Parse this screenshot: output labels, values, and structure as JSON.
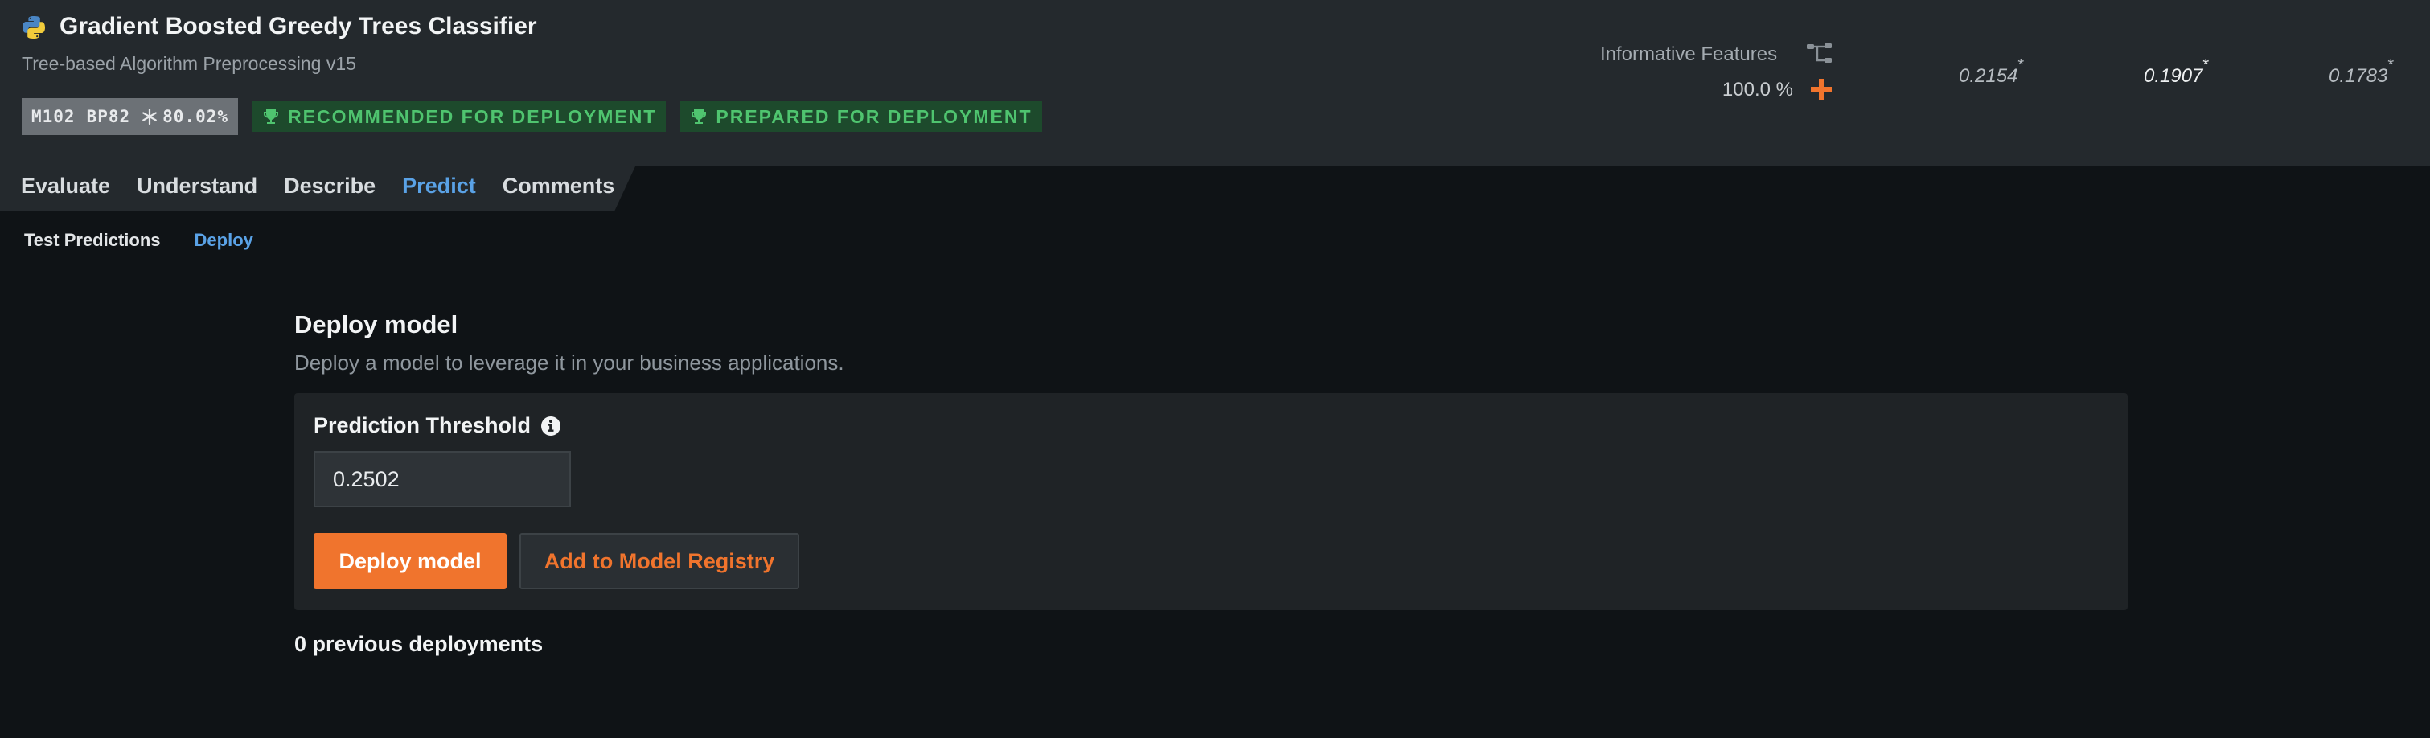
{
  "model": {
    "title": "Gradient Boosted Greedy Trees Classifier",
    "subtitle": "Tree-based Algorithm Preprocessing v15",
    "icon": "python-icon",
    "id_badge": {
      "model_id": "M102",
      "blueprint": "BP82",
      "sample_pct": "80.02%"
    },
    "tags": [
      "RECOMMENDED FOR DEPLOYMENT",
      "PREPARED FOR DEPLOYMENT"
    ]
  },
  "features": {
    "label": "Informative Features",
    "value": "100.0 %"
  },
  "metrics": [
    {
      "value": "0.2154",
      "mark": "*"
    },
    {
      "value": "0.1907",
      "mark": "*"
    },
    {
      "value": "0.1783",
      "mark": "*"
    }
  ],
  "tabs": [
    {
      "label": "Evaluate",
      "active": false
    },
    {
      "label": "Understand",
      "active": false
    },
    {
      "label": "Describe",
      "active": false
    },
    {
      "label": "Predict",
      "active": true
    },
    {
      "label": "Comments",
      "active": false
    }
  ],
  "subtabs": [
    {
      "label": "Test Predictions",
      "active": false
    },
    {
      "label": "Deploy",
      "active": true
    }
  ],
  "deploy": {
    "title": "Deploy model",
    "description": "Deploy a model to leverage it in your business applications.",
    "threshold_label": "Prediction Threshold",
    "threshold_value": "0.2502",
    "deploy_button": "Deploy model",
    "registry_button": "Add to Model Registry",
    "previous": "0 previous deployments"
  },
  "colors": {
    "accent_orange": "#f0742d",
    "active_blue": "#5aa2e6",
    "success_green": "#4fc46f",
    "header_bg": "#24292d",
    "page_bg": "#0f1316"
  }
}
